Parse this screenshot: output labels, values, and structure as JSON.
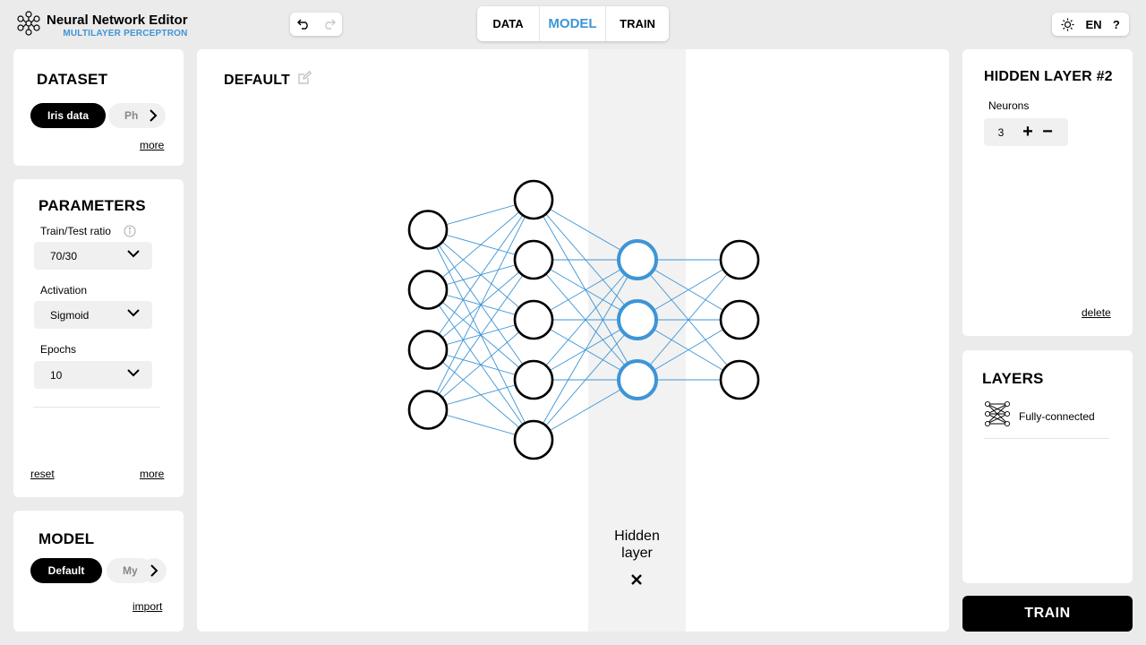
{
  "brand": {
    "title": "Neural Network Editor",
    "subtitle": "MULTILAYER PERCEPTRON"
  },
  "tabs": [
    {
      "label": "DATA",
      "active": false
    },
    {
      "label": "MODEL",
      "active": true
    },
    {
      "label": "TRAIN",
      "active": false
    }
  ],
  "top_right": {
    "theme_icon": "sun-icon",
    "language": "EN",
    "help": "?"
  },
  "dataset": {
    "title": "DATASET",
    "items": [
      "Iris data",
      "Ph"
    ],
    "selected": "Iris data",
    "more_label": "more"
  },
  "parameters": {
    "title": "PARAMETERS",
    "train_test_label": "Train/Test ratio",
    "train_test_value": "70/30",
    "activation_label": "Activation",
    "activation_value": "Sigmoid",
    "epochs_label": "Epochs",
    "epochs_value": "10",
    "reset_label": "reset",
    "more_label": "more"
  },
  "model": {
    "title": "MODEL",
    "items": [
      "Default",
      "My"
    ],
    "selected": "Default",
    "import_label": "import"
  },
  "canvas": {
    "model_name": "DEFAULT",
    "network": {
      "layers": [
        4,
        5,
        3,
        3
      ],
      "selected_layer": 2
    },
    "hidden_layer_label_line1": "Hidden",
    "hidden_layer_label_line2": "layer",
    "remove_icon": "close-icon",
    "colors": {
      "edge": "#3d95d6",
      "selected_node": "#3d95d6",
      "node": "#000000",
      "selected_band": "#f2f2f2"
    }
  },
  "hidden_layer_panel": {
    "title": "HIDDEN LAYER #2",
    "neurons_label": "Neurons",
    "neurons_value": "3",
    "plus": "+",
    "minus": "−",
    "delete_label": "delete"
  },
  "layers_panel": {
    "title": "LAYERS",
    "items": [
      {
        "label": "Fully-connected",
        "icon": "fully-connected-icon"
      }
    ]
  },
  "train_button": "TRAIN"
}
